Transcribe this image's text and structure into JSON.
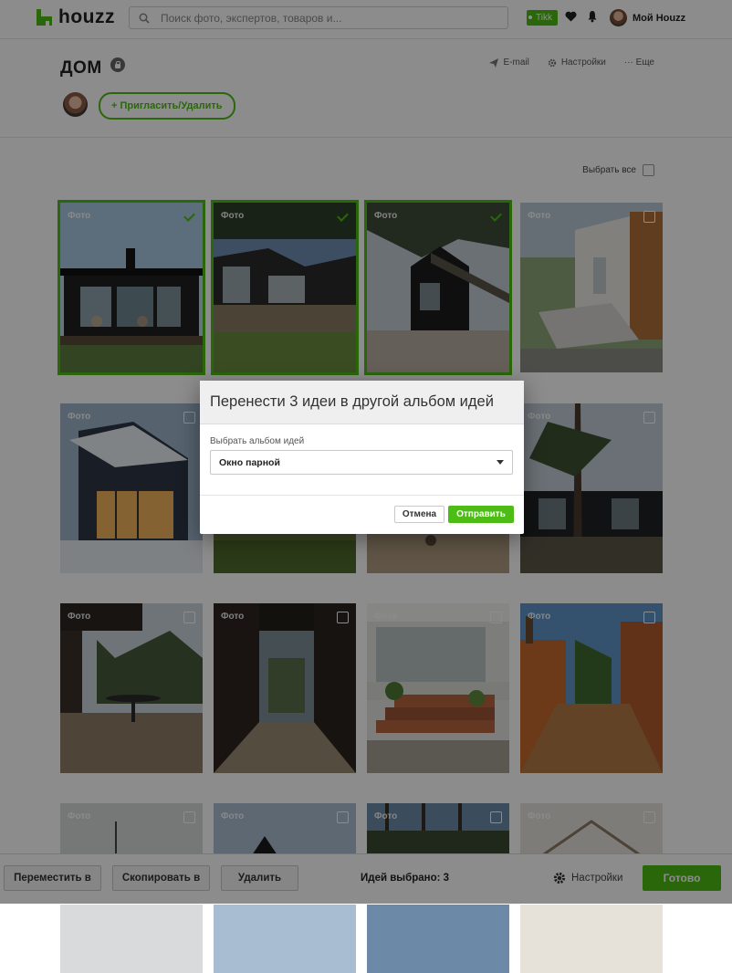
{
  "header": {
    "logo_text": "houzz",
    "search_placeholder": "Поиск фото, экспертов, товаров и...",
    "badge": "Tikk",
    "my_houzz": "Мой Houzz"
  },
  "album": {
    "title": "ДОМ",
    "actions": [
      "E-mail",
      "Настройки",
      "··· Еще"
    ],
    "invite_label": "+ Пригласить/Удалить"
  },
  "grid": {
    "select_all_label": "Выбрать все",
    "tile_label": "Фото",
    "selected": [
      true,
      true,
      true,
      false,
      false,
      false,
      false,
      false,
      false,
      false,
      false,
      false,
      false,
      false,
      false,
      false
    ]
  },
  "modal": {
    "title": "Перенести 3 идеи в другой альбом идей",
    "select_label": "Выбрать альбом идей",
    "selected_album": "Окно парной",
    "cancel_label": "Отмена",
    "submit_label": "Отправить"
  },
  "bottom_bar": {
    "move_label": "Переместить в",
    "copy_label": "Скопировать в",
    "delete_label": "Удалить",
    "selected_count": "Идей выбрано: 3",
    "settings_label": "Настройки",
    "done_label": "Готово"
  },
  "colors": {
    "accent": "#4dbc15"
  }
}
